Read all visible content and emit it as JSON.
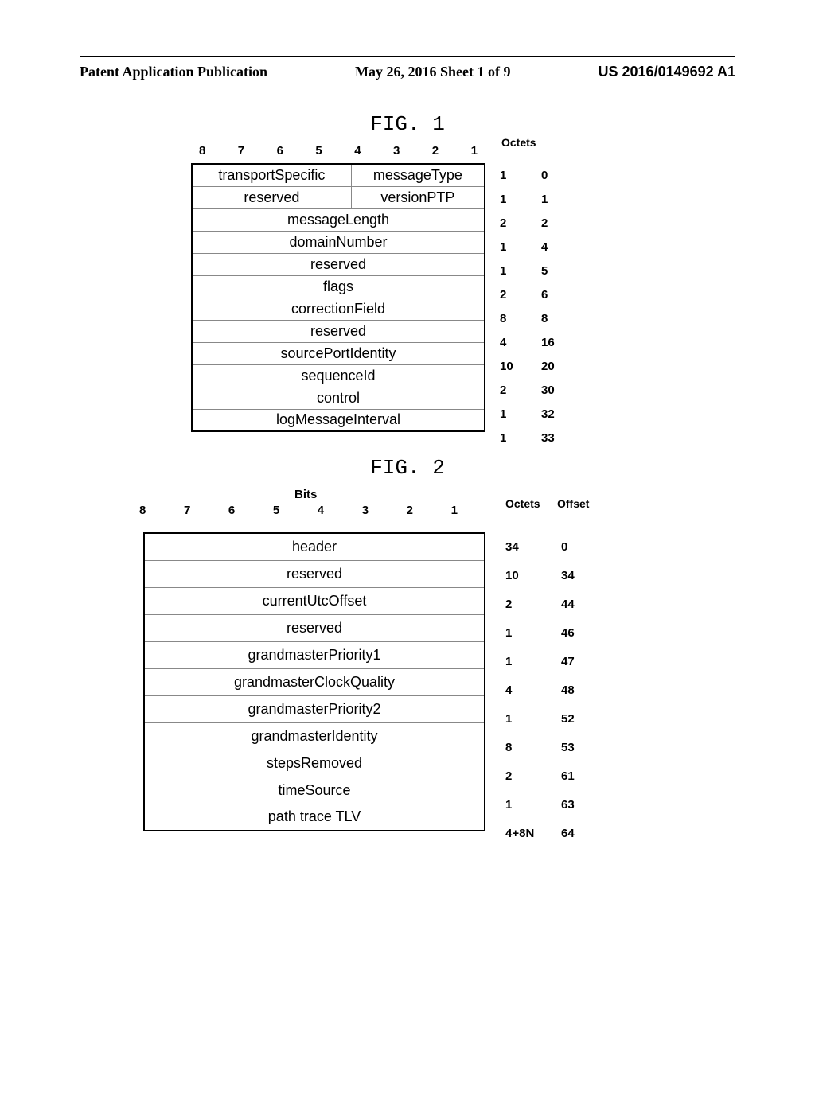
{
  "header": {
    "left": "Patent Application Publication",
    "center": "May 26, 2016  Sheet 1 of 9",
    "right": "US 2016/0149692 A1"
  },
  "fig1": {
    "title": "FIG. 1",
    "bits_label": "",
    "bit_nums": [
      "8",
      "7",
      "6",
      "5",
      "4",
      "3",
      "2",
      "1"
    ],
    "octets_label": "Octets",
    "offset_label": "",
    "chart_data": {
      "type": "table",
      "rows": [
        {
          "cells": [
            {
              "text": "transportSpecific",
              "span": 4
            },
            {
              "text": "messageType",
              "span": 4
            }
          ],
          "octets": "1",
          "offset": "0"
        },
        {
          "cells": [
            {
              "text": "reserved",
              "span": 4
            },
            {
              "text": "versionPTP",
              "span": 4
            }
          ],
          "octets": "1",
          "offset": "1"
        },
        {
          "cells": [
            {
              "text": "messageLength",
              "span": 8
            }
          ],
          "octets": "2",
          "offset": "2"
        },
        {
          "cells": [
            {
              "text": "domainNumber",
              "span": 8
            }
          ],
          "octets": "1",
          "offset": "4"
        },
        {
          "cells": [
            {
              "text": "reserved",
              "span": 8
            }
          ],
          "octets": "1",
          "offset": "5"
        },
        {
          "cells": [
            {
              "text": "flags",
              "span": 8
            }
          ],
          "octets": "2",
          "offset": "6"
        },
        {
          "cells": [
            {
              "text": "correctionField",
              "span": 8
            }
          ],
          "octets": "8",
          "offset": "8"
        },
        {
          "cells": [
            {
              "text": "reserved",
              "span": 8
            }
          ],
          "octets": "4",
          "offset": "16"
        },
        {
          "cells": [
            {
              "text": "sourcePortIdentity",
              "span": 8
            }
          ],
          "octets": "10",
          "offset": "20"
        },
        {
          "cells": [
            {
              "text": "sequenceId",
              "span": 8
            }
          ],
          "octets": "2",
          "offset": "30"
        },
        {
          "cells": [
            {
              "text": "control",
              "span": 8
            }
          ],
          "octets": "1",
          "offset": "32"
        },
        {
          "cells": [
            {
              "text": "logMessageInterval",
              "span": 8
            }
          ],
          "octets": "1",
          "offset": "33"
        }
      ]
    }
  },
  "fig2": {
    "title": "FIG. 2",
    "bits_label": "Bits",
    "bit_nums": [
      "8",
      "7",
      "6",
      "5",
      "4",
      "3",
      "2",
      "1"
    ],
    "octets_label": "Octets",
    "offset_label": "Offset",
    "chart_data": {
      "type": "table",
      "rows": [
        {
          "cells": [
            {
              "text": "header",
              "span": 8
            }
          ],
          "octets": "34",
          "offset": "0"
        },
        {
          "cells": [
            {
              "text": "reserved",
              "span": 8
            }
          ],
          "octets": "10",
          "offset": "34"
        },
        {
          "cells": [
            {
              "text": "currentUtcOffset",
              "span": 8
            }
          ],
          "octets": "2",
          "offset": "44"
        },
        {
          "cells": [
            {
              "text": "reserved",
              "span": 8
            }
          ],
          "octets": "1",
          "offset": "46"
        },
        {
          "cells": [
            {
              "text": "grandmasterPriority1",
              "span": 8
            }
          ],
          "octets": "1",
          "offset": "47"
        },
        {
          "cells": [
            {
              "text": "grandmasterClockQuality",
              "span": 8
            }
          ],
          "octets": "4",
          "offset": "48"
        },
        {
          "cells": [
            {
              "text": "grandmasterPriority2",
              "span": 8
            }
          ],
          "octets": "1",
          "offset": "52"
        },
        {
          "cells": [
            {
              "text": "grandmasterIdentity",
              "span": 8
            }
          ],
          "octets": "8",
          "offset": "53"
        },
        {
          "cells": [
            {
              "text": "stepsRemoved",
              "span": 8
            }
          ],
          "octets": "2",
          "offset": "61"
        },
        {
          "cells": [
            {
              "text": "timeSource",
              "span": 8
            }
          ],
          "octets": "1",
          "offset": "63"
        },
        {
          "cells": [
            {
              "text": "path trace TLV",
              "span": 8
            }
          ],
          "octets": "4+8N",
          "offset": "64"
        }
      ]
    }
  }
}
